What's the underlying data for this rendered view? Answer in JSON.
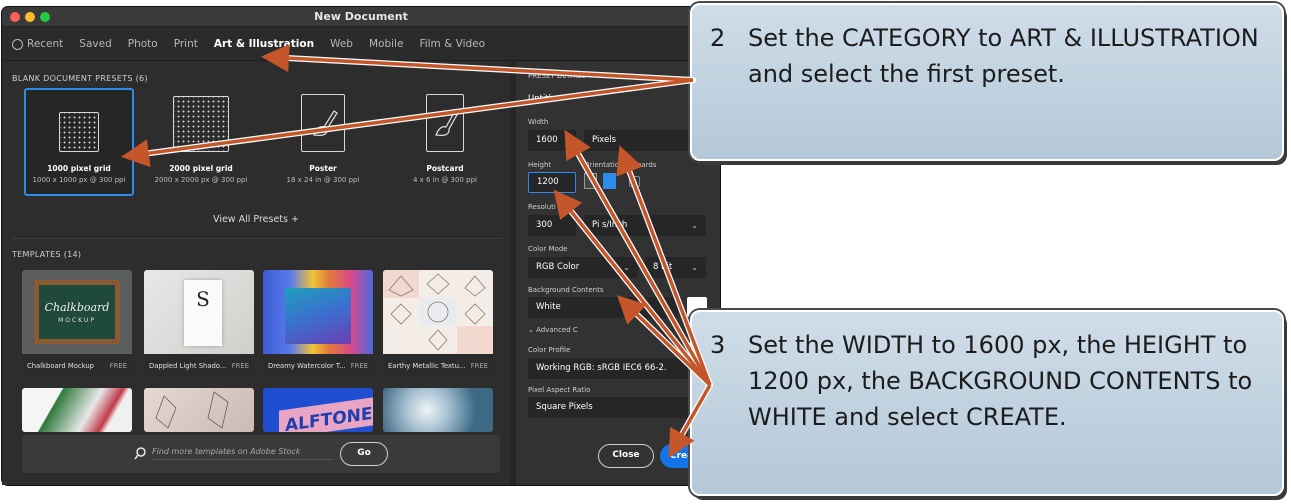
{
  "window": {
    "title": "New Document",
    "tabs": [
      {
        "label": "Recent",
        "active": false
      },
      {
        "label": "Saved",
        "active": false
      },
      {
        "label": "Photo",
        "active": false
      },
      {
        "label": "Print",
        "active": false
      },
      {
        "label": "Art & Illustration",
        "active": true
      },
      {
        "label": "Web",
        "active": false
      },
      {
        "label": "Mobile",
        "active": false
      },
      {
        "label": "Film & Video",
        "active": false
      }
    ]
  },
  "presets": {
    "heading": "BLANK DOCUMENT PRESETS  (6)",
    "items": [
      {
        "name": "1000 pixel grid",
        "dims": "1000 x 1000 px @ 300 ppi",
        "selected": true
      },
      {
        "name": "2000 pixel grid",
        "dims": "2000 x 2000 px @ 300 ppi",
        "selected": false
      },
      {
        "name": "Poster",
        "dims": "18 x 24 in @ 300 ppi",
        "selected": false
      },
      {
        "name": "Postcard",
        "dims": "4 x 6 in @ 300 ppi",
        "selected": false
      }
    ],
    "view_all": "View All Presets +"
  },
  "templates": {
    "heading": "TEMPLATES  (14)",
    "items": [
      {
        "name": "Chalkboard Mockup",
        "badge": "FREE"
      },
      {
        "name": "Dappled Light Shado...",
        "badge": "FREE"
      },
      {
        "name": "Dreamy Watercolor T...",
        "badge": "FREE"
      },
      {
        "name": "Earthy Metallic Textu...",
        "badge": "FREE"
      }
    ],
    "chalk_text": "Chalkboard",
    "chalk_sub": "MOCKUP",
    "dappled_letter": "S",
    "halftone_text": "ALFTONE"
  },
  "search": {
    "placeholder": "Find more templates on Adobe Stock",
    "go_label": "Go"
  },
  "details": {
    "heading": "PRESET DETAILS",
    "name_partial": "Untitl",
    "width_label": "Width",
    "width_value": "1600",
    "units_value": "Pixels",
    "height_label": "Height",
    "height_value": "1200",
    "orientation_label": "Orientation",
    "artboards_label": "rtboards",
    "resolution_label": "Resoluti",
    "resolution_value": "300",
    "resolution_units": "Pi   s/Inch",
    "color_mode_label": "Color Mode",
    "color_mode_value": "RGB Color",
    "bit_depth": "8 bit",
    "background_label": "Background Contents",
    "background_value": "White",
    "background_swatch": "#ffffff",
    "advanced_label": "Advanced C",
    "color_profile_label": "Color Profile",
    "color_profile_value": "Working RGB: sRGB IEC6  66-2.",
    "pixel_aspect_label": "Pixel Aspect Ratio",
    "pixel_aspect_value": "Square Pixels",
    "close_label": "Close",
    "create_label": "Crea"
  },
  "callouts": {
    "step2": {
      "number": "2",
      "text": "Set the CATEGORY to ART & ILLUSTRATION and select the first preset."
    },
    "step3": {
      "number": "3",
      "text": "Set the WIDTH to 1600 px, the HEIGHT to 1200 px, the BACKGROUND CONTENTS to WHITE and select CREATE."
    }
  },
  "colors": {
    "accent": "#2d8ceb",
    "arrow": "#c4562a",
    "create_button": "#1473e6"
  }
}
